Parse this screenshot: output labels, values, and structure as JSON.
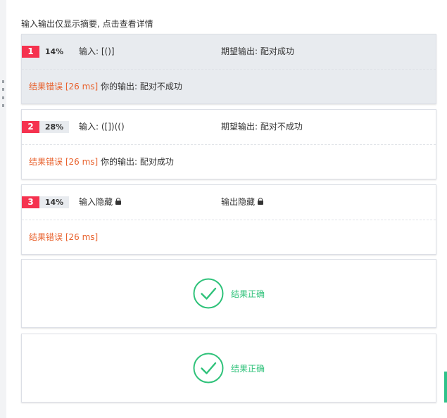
{
  "summary": "输入输出仅显示摘要, 点击查看详情",
  "cases": [
    {
      "num": "1",
      "percent": "14%",
      "input": "输入: [()]",
      "expected": "期望输出: 配对成功",
      "status": "结果错误 [26 ms]",
      "actual": "你的输出: 配对不成功"
    },
    {
      "num": "2",
      "percent": "28%",
      "input": "输入: ([])(()",
      "expected": "期望输出: 配对不成功",
      "status": "结果错误 [26 ms]",
      "actual": "你的输出: 配对成功"
    },
    {
      "num": "3",
      "percent": "14%",
      "input": "输入隐藏",
      "expected": "输出隐藏",
      "status": "结果错误 [26 ms]"
    }
  ],
  "correct_results": [
    {
      "label": "结果正确"
    },
    {
      "label": "结果正确"
    }
  ],
  "colors": {
    "badge": "#f5324f",
    "error": "#e8612c",
    "success": "#2fc27a"
  }
}
